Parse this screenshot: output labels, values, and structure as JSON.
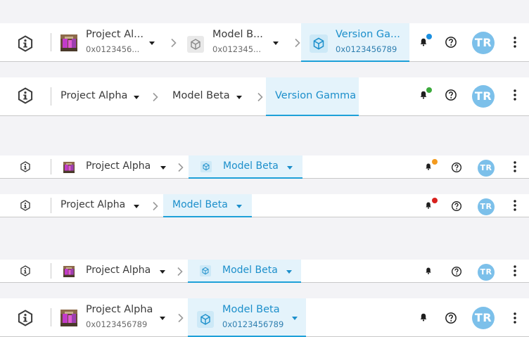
{
  "colors": {
    "accent": "#1ea0d8",
    "avatar_bg": "#7cc0ea",
    "notification_blue": "#1a8fe0",
    "notification_green": "#3caa3c",
    "notification_orange": "#f39a1e",
    "notification_red": "#d8211e"
  },
  "bars": [
    {
      "project": {
        "label": "Project Al...",
        "sub": "0x0123456...",
        "icon": "project-thumbnail-icon"
      },
      "model": {
        "label": "Model B...",
        "sub": "0x012345...",
        "icon": "cube-icon"
      },
      "version": {
        "label": "Version Ga...",
        "sub": "0x0123456789",
        "icon": "cube-icon"
      },
      "notification_color": "#1a8fe0",
      "avatar": "TR"
    },
    {
      "project": {
        "label": "Project Alpha"
      },
      "model": {
        "label": "Model Beta"
      },
      "version": {
        "label": "Version Gamma"
      },
      "notification_color": "#3caa3c",
      "avatar": "TR"
    },
    {
      "project": {
        "label": "Project Alpha",
        "icon": "project-thumbnail-icon"
      },
      "model": {
        "label": "Model Beta",
        "icon": "cube-icon"
      },
      "notification_color": "#f39a1e",
      "avatar": "TR"
    },
    {
      "project": {
        "label": "Project Alpha"
      },
      "model": {
        "label": "Model Beta"
      },
      "notification_color": "#d8211e",
      "avatar": "TR"
    },
    {
      "project": {
        "label": "Project Alpha",
        "icon": "project-thumbnail-icon"
      },
      "model": {
        "label": "Model Beta",
        "icon": "cube-icon"
      },
      "avatar": "TR"
    },
    {
      "project": {
        "label": "Project Alpha",
        "sub": "0x0123456789",
        "icon": "project-thumbnail-icon"
      },
      "model": {
        "label": "Model Beta",
        "sub": "0x0123456789",
        "icon": "cube-icon"
      },
      "avatar": "TR"
    }
  ]
}
